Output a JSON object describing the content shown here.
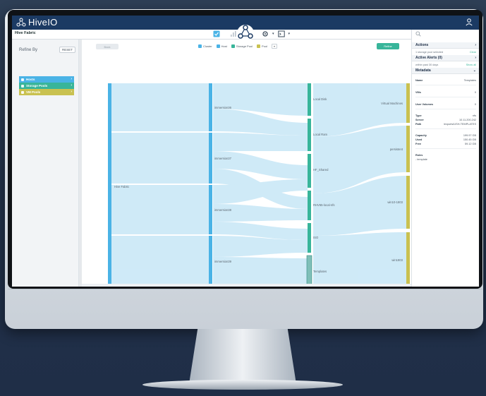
{
  "app": {
    "logo_text": "HiveIO",
    "page_title": "Hive Fabric"
  },
  "sidebar": {
    "refine_label": "Refine By",
    "reset_label": "RESET",
    "filters": [
      {
        "label": "Hosts",
        "color": "#4ab3e6"
      },
      {
        "label": "Storage Pools",
        "color": "#38b59a"
      },
      {
        "label": "VM Pools",
        "color": "#c9c150"
      }
    ]
  },
  "main": {
    "back_label": "Back",
    "refine_label": "Refine",
    "legend": [
      {
        "num": "1",
        "label": "Cluster",
        "color": "#4ab3e6"
      },
      {
        "num": "2",
        "label": "Host",
        "color": "#4ab3e6"
      },
      {
        "num": "3",
        "label": "Storage Pool",
        "color": "#38b59a"
      },
      {
        "num": "4",
        "label": "Pool",
        "color": "#c9c150"
      }
    ],
    "legend_dropdown": "▾"
  },
  "sankey": {
    "cluster": [
      "Hive Fabric"
    ],
    "hosts": [
      "immersion36",
      "immersion37",
      "immersion38",
      "immersion39"
    ],
    "storage": [
      "Local Disk",
      "Local Ram",
      "HF_Shared",
      "RHV65-local-nfs",
      "ISO",
      "Templates"
    ],
    "pools": [
      "Virtual Machines",
      "persistent",
      "win10-1803",
      "win1803"
    ],
    "colors": {
      "cluster": "#4ab3e6",
      "host": "#4ab3e6",
      "storage": "#38b59a",
      "pool": "#c9c150",
      "link": "#bfe3f5"
    }
  },
  "rpanel": {
    "actions": {
      "title": "Actions",
      "row_left": "1 storage pool selected",
      "row_right": "Clear"
    },
    "alerts": {
      "title": "Active Alerts (0)",
      "row_left": "within past 30 days",
      "row_right": "Show all"
    },
    "metadata": {
      "title": "Metadata",
      "name_k": "Name",
      "name_v": "Templates",
      "vms_k": "VMs",
      "vms_v": "0",
      "uv_k": "User Volumes",
      "uv_v": "0",
      "type_k": "Type",
      "type_v": "nfs",
      "server_k": "Server",
      "server_v": "10.11.200.242",
      "path_k": "Path",
      "path_v": "/exports/USH-TEMPLATES",
      "cap_k": "Capacity",
      "cap_v": "199.97 GB",
      "used_k": "Used",
      "used_v": "150.45 GB",
      "free_k": "Free",
      "free_v": "59.12 GB",
      "roles_k": "Roles",
      "roles_v": "- template"
    }
  }
}
